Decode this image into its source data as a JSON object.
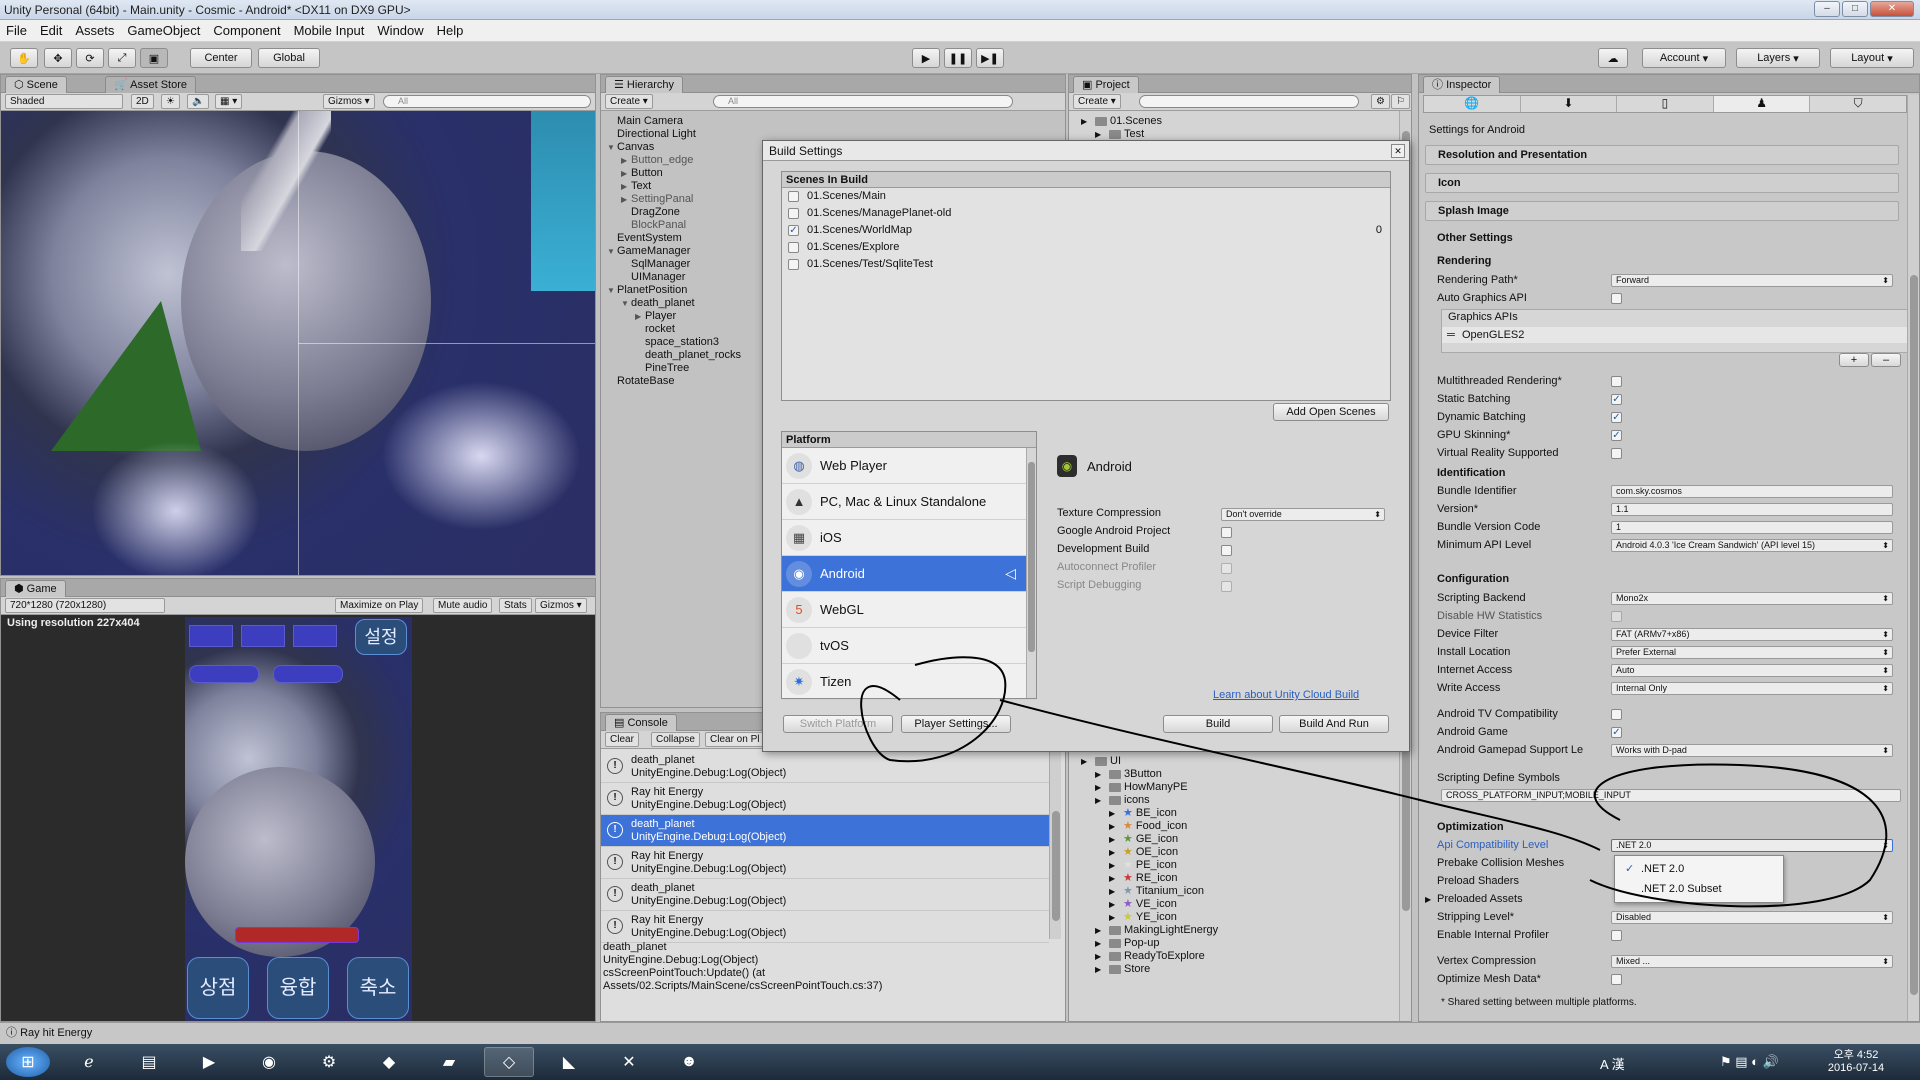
{
  "window": {
    "title": "Unity Personal (64bit) - Main.unity - Cosmic - Android* <DX11 on DX9 GPU>"
  },
  "menu": [
    "File",
    "Edit",
    "Assets",
    "GameObject",
    "Component",
    "Mobile Input",
    "Window",
    "Help"
  ],
  "toolbar": {
    "center_label": "Center",
    "global_label": "Global",
    "account_label": "Account",
    "layers_label": "Layers",
    "layout_label": "Layout"
  },
  "scene": {
    "tab_scene": "Scene",
    "tab_asset_store": "Asset Store",
    "shaded": "Shaded",
    "mode_2d": "2D",
    "gizmos": "Gizmos",
    "search_placeholder": "All"
  },
  "game": {
    "tab": "Game",
    "resolution": "720*1280 (720x1280)",
    "maximize": "Maximize on Play",
    "mute": "Mute audio",
    "stats": "Stats",
    "gizmos": "Gizmos",
    "using_res": "Using resolution 227x404",
    "settings_btn": "설정",
    "btn_shop": "상점",
    "btn_merge": "융합",
    "btn_shrink": "축소"
  },
  "hierarchy": {
    "tab": "Hierarchy",
    "create": "Create",
    "search_placeholder": "All",
    "items": [
      {
        "label": "Main Camera",
        "indent": 0
      },
      {
        "label": "Directional Light",
        "indent": 0
      },
      {
        "label": "Canvas",
        "indent": 0,
        "arrow": "▼"
      },
      {
        "label": "Button_edge",
        "indent": 1,
        "arrow": "▶",
        "dim": true
      },
      {
        "label": "Button",
        "indent": 1,
        "arrow": "▶"
      },
      {
        "label": "Text",
        "indent": 1,
        "arrow": "▶"
      },
      {
        "label": "SettingPanal",
        "indent": 1,
        "arrow": "▶",
        "dim": true
      },
      {
        "label": "DragZone",
        "indent": 1
      },
      {
        "label": "BlockPanal",
        "indent": 1,
        "dim": true
      },
      {
        "label": "EventSystem",
        "indent": 0
      },
      {
        "label": "GameManager",
        "indent": 0,
        "arrow": "▼"
      },
      {
        "label": "SqlManager",
        "indent": 1
      },
      {
        "label": "UIManager",
        "indent": 1
      },
      {
        "label": "PlanetPosition",
        "indent": 0,
        "arrow": "▼"
      },
      {
        "label": "death_planet",
        "indent": 1,
        "arrow": "▼"
      },
      {
        "label": "Player",
        "indent": 2,
        "arrow": "▶"
      },
      {
        "label": "rocket",
        "indent": 2
      },
      {
        "label": "space_station3",
        "indent": 2
      },
      {
        "label": "death_planet_rocks",
        "indent": 2
      },
      {
        "label": "PineTree",
        "indent": 2
      },
      {
        "label": "RotateBase",
        "indent": 0
      }
    ]
  },
  "project": {
    "tab": "Project",
    "create": "Create",
    "top_items": [
      {
        "label": "01.Scenes",
        "indent": 0
      },
      {
        "label": "Test",
        "indent": 1
      }
    ],
    "items": [
      {
        "label": "UI",
        "indent": 0
      },
      {
        "label": "3Button",
        "indent": 1
      },
      {
        "label": "HowManyPE",
        "indent": 1
      },
      {
        "label": "icons",
        "indent": 1
      },
      {
        "label": "BE_icon",
        "indent": 2,
        "star": "#3a6fd8"
      },
      {
        "label": "Food_icon",
        "indent": 2,
        "star": "#d88a3a"
      },
      {
        "label": "GE_icon",
        "indent": 2,
        "star": "#5a9a3a"
      },
      {
        "label": "OE_icon",
        "indent": 2,
        "star": "#c8a030"
      },
      {
        "label": "PE_icon",
        "indent": 2,
        "star": "#e0e0e0"
      },
      {
        "label": "RE_icon",
        "indent": 2,
        "star": "#c83a3a"
      },
      {
        "label": "Titanium_icon",
        "indent": 2,
        "star": "#7a9ab0"
      },
      {
        "label": "VE_icon",
        "indent": 2,
        "star": "#8a5ac8"
      },
      {
        "label": "YE_icon",
        "indent": 2,
        "star": "#c8c83a"
      },
      {
        "label": "MakingLightEnergy",
        "indent": 1
      },
      {
        "label": "Pop-up",
        "indent": 1
      },
      {
        "label": "ReadyToExplore",
        "indent": 1
      },
      {
        "label": "Store",
        "indent": 1
      }
    ]
  },
  "console": {
    "tab": "Console",
    "clear": "Clear",
    "collapse": "Collapse",
    "clear_on_play": "Clear on Pl",
    "rows": [
      {
        "line1": "death_planet",
        "line2": "UnityEngine.Debug:Log(Object)",
        "selected": false
      },
      {
        "line1": "Ray hit Energy",
        "line2": "UnityEngine.Debug:Log(Object)",
        "selected": false
      },
      {
        "line1": "death_planet",
        "line2": "UnityEngine.Debug:Log(Object)",
        "selected": true
      },
      {
        "line1": "Ray hit Energy",
        "line2": "UnityEngine.Debug:Log(Object)",
        "selected": false
      },
      {
        "line1": "death_planet",
        "line2": "UnityEngine.Debug:Log(Object)",
        "selected": false
      },
      {
        "line1": "Ray hit Energy",
        "line2": "UnityEngine.Debug:Log(Object)",
        "selected": false
      }
    ],
    "detail": [
      "death_planet",
      "UnityEngine.Debug:Log(Object)",
      "csScreenPointTouch:Update() (at",
      "Assets/02.Scripts/MainScene/csScreenPointTouch.cs:37)"
    ]
  },
  "build": {
    "title": "Build Settings",
    "scenes_header": "Scenes In Build",
    "scenes": [
      {
        "name": "01.Scenes/Main",
        "checked": false,
        "index": ""
      },
      {
        "name": "01.Scenes/ManagePlanet-old",
        "checked": false,
        "index": ""
      },
      {
        "name": "01.Scenes/WorldMap",
        "checked": true,
        "index": "0"
      },
      {
        "name": "01.Scenes/Explore",
        "checked": false,
        "index": ""
      },
      {
        "name": "01.Scenes/Test/SqliteTest",
        "checked": false,
        "index": ""
      }
    ],
    "add_open_scenes": "Add Open Scenes",
    "platform_header": "Platform",
    "platforms": [
      {
        "name": "Web Player",
        "icon": "globe-icon",
        "selected": false
      },
      {
        "name": "PC, Mac & Linux Standalone",
        "icon": "penguin-icon",
        "selected": false
      },
      {
        "name": "iOS",
        "icon": "ios-icon",
        "selected": false
      },
      {
        "name": "Android",
        "icon": "android-icon",
        "selected": true
      },
      {
        "name": "WebGL",
        "icon": "html5-icon",
        "selected": false
      },
      {
        "name": "tvOS",
        "icon": "apple-tv-icon",
        "selected": false
      },
      {
        "name": "Tizen",
        "icon": "tizen-icon",
        "selected": false
      }
    ],
    "selected_platform": "Android",
    "options": [
      {
        "label": "Texture Compression",
        "type": "dropdown",
        "value": "Don't override"
      },
      {
        "label": "Google Android Project",
        "type": "check",
        "value": false
      },
      {
        "label": "Development Build",
        "type": "check",
        "value": false
      },
      {
        "label": "Autoconnect Profiler",
        "type": "check",
        "value": false,
        "disabled": true
      },
      {
        "label": "Script Debugging",
        "type": "check",
        "value": false,
        "disabled": true
      }
    ],
    "cloud_link": "Learn about Unity Cloud Build",
    "switch_platform": "Switch Platform",
    "player_settings": "Player Settings...",
    "build": "Build",
    "build_and_run": "Build And Run"
  },
  "inspector": {
    "tab": "Inspector",
    "settings_for": "Settings for Android",
    "sections": [
      "Resolution and Presentation",
      "Icon",
      "Splash Image"
    ],
    "other_settings": "Other Settings",
    "rendering_head": "Rendering",
    "rendering_path_label": "Rendering Path*",
    "rendering_path": "Forward",
    "auto_graphics_label": "Auto Graphics API",
    "graphics_apis_label": "Graphics APIs",
    "graphics_api_item": "OpenGLES2",
    "checks": [
      {
        "label": "Multithreaded Rendering*",
        "value": false
      },
      {
        "label": "Static Batching",
        "value": true
      },
      {
        "label": "Dynamic Batching",
        "value": true
      },
      {
        "label": "GPU Skinning*",
        "value": true
      },
      {
        "label": "Virtual Reality Supported",
        "value": false
      }
    ],
    "identification_head": "Identification",
    "bundle_id_label": "Bundle Identifier",
    "bundle_id": "com.sky.cosmos",
    "version_label": "Version*",
    "version": "1.1",
    "bundle_code_label": "Bundle Version Code",
    "bundle_code": "1",
    "min_api_label": "Minimum API Level",
    "min_api": "Android 4.0.3 'Ice Cream Sandwich' (API level 15)",
    "configuration_head": "Configuration",
    "scripting_backend_label": "Scripting Backend",
    "scripting_backend": "Mono2x",
    "disable_hw_label": "Disable HW Statistics",
    "device_filter_label": "Device Filter",
    "device_filter": "FAT (ARMv7+x86)",
    "install_location_label": "Install Location",
    "install_location": "Prefer External",
    "internet_label": "Internet Access",
    "internet": "Auto",
    "write_label": "Write Access",
    "write": "Internal Only",
    "tv_compat_label": "Android TV Compatibility",
    "android_game_label": "Android Game",
    "gamepad_label": "Android Gamepad Support Le",
    "gamepad": "Works with D-pad",
    "define_symbols_label": "Scripting Define Symbols",
    "define_symbols": "CROSS_PLATFORM_INPUT;MOBILE_INPUT",
    "optimization_head": "Optimization",
    "api_compat_label": "Api Compatibility Level",
    "api_compat": ".NET 2.0",
    "dropdown_options": [
      ".NET 2.0",
      ".NET 2.0 Subset"
    ],
    "prebake_label": "Prebake Collision Meshes",
    "preload_shaders_label": "Preload Shaders",
    "preloaded_assets_label": "Preloaded Assets",
    "stripping_label": "Stripping Level*",
    "stripping": "Disabled",
    "internal_profiler_label": "Enable Internal Profiler",
    "vertex_comp_label": "Vertex Compression",
    "vertex_comp": "Mixed ...",
    "optimize_mesh_label": "Optimize Mesh Data*",
    "shared_note": "* Shared setting between multiple platforms."
  },
  "status": {
    "text": "Ray hit Energy"
  },
  "taskbar": {
    "time": "오후 4:52",
    "date": "2016-07-14",
    "tray": "A 漢"
  }
}
